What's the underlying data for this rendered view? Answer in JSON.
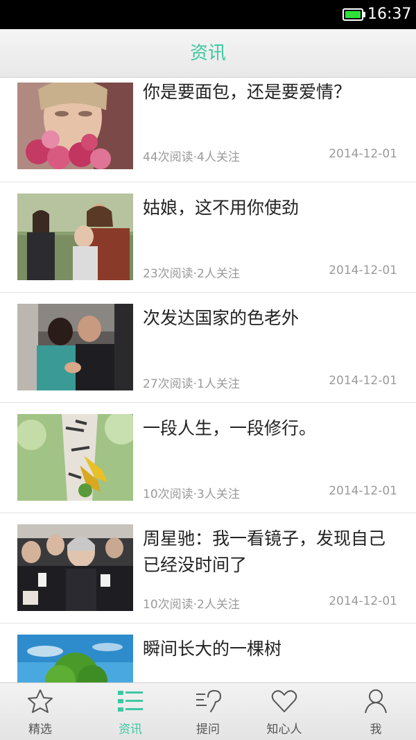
{
  "status_bar": {
    "time": "16:37",
    "battery_level": 1.0,
    "battery_color": "#2fe03a"
  },
  "header": {
    "title": "资讯"
  },
  "articles": [
    {
      "title": "你是要面包，还是要爱情？",
      "meta": "44次阅读·4人关注",
      "date": "2014-12-01",
      "image": "woman-with-roses"
    },
    {
      "title": "姑娘，这不用你使劲",
      "meta": "23次阅读·2人关注",
      "date": "2014-12-01",
      "image": "couple-in-park"
    },
    {
      "title": "次发达国家的色老外",
      "meta": "27次阅读·1人关注",
      "date": "2014-12-01",
      "image": "couple-kissing"
    },
    {
      "title": "一段人生，一段修行。",
      "meta": "10次阅读·3人关注",
      "date": "2014-12-01",
      "image": "shoes-on-birch-tree"
    },
    {
      "title": "周星驰：我一看镜子，发现自己已经没时间了",
      "meta": "10次阅读·2人关注",
      "date": "2014-12-01",
      "image": "press-crowd"
    },
    {
      "title": "瞬间长大的一棵树",
      "meta": "",
      "date": "",
      "image": "green-tree"
    }
  ],
  "nav": {
    "items": [
      {
        "label": "精选",
        "icon": "star-icon",
        "active": false
      },
      {
        "label": "资讯",
        "icon": "list-icon",
        "active": true
      },
      {
        "label": "提问",
        "icon": "question-icon",
        "active": false
      },
      {
        "label": "知心人",
        "icon": "heart-icon",
        "active": false
      },
      {
        "label": "我",
        "icon": "person-icon",
        "active": false
      }
    ],
    "active_color": "#3cc8a0",
    "inactive_color": "#555555"
  }
}
